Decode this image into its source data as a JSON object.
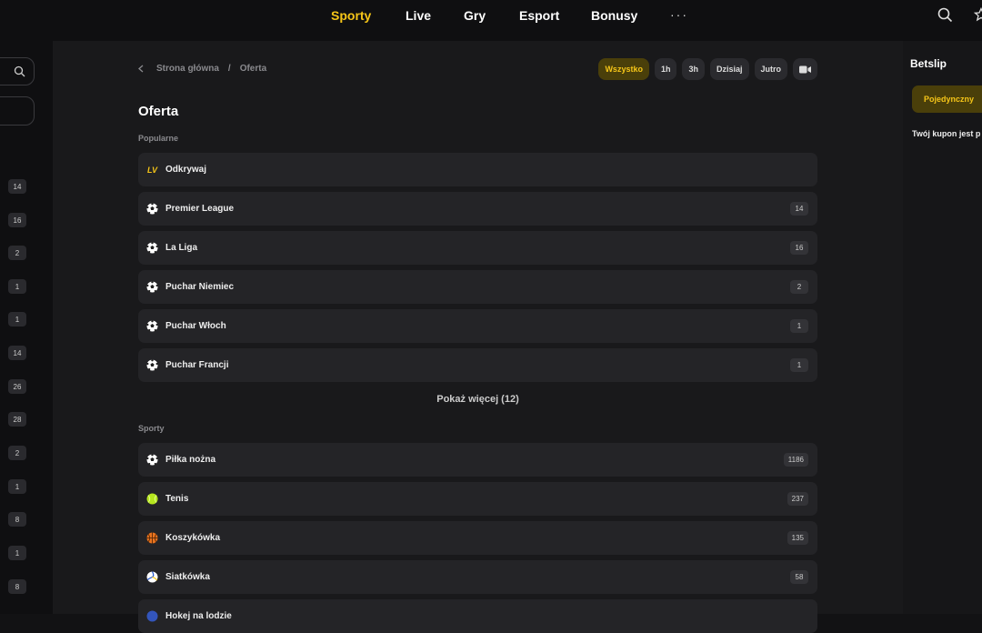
{
  "nav": {
    "items": [
      {
        "label": "Sporty",
        "active": true
      },
      {
        "label": "Live",
        "active": false
      },
      {
        "label": "Gry",
        "active": false
      },
      {
        "label": "Esport",
        "active": false
      },
      {
        "label": "Bonusy",
        "active": false
      }
    ],
    "more": "···",
    "icons": [
      "search-icon",
      "star-icon"
    ]
  },
  "sidebar": {
    "counts": [
      "14",
      "16",
      "2",
      "1",
      "1",
      "14",
      "26",
      "28",
      "2",
      "1",
      "8",
      "1",
      "8"
    ]
  },
  "breadcrumb": {
    "home": "Strona główna",
    "separator": "/",
    "current": "Oferta"
  },
  "filters": [
    "Wszystko",
    "1h",
    "3h",
    "Dzisiaj",
    "Jutro"
  ],
  "page_title": "Oferta",
  "popular": {
    "label": "Popularne",
    "items": [
      {
        "label": "Odkrywaj",
        "icon": "lv-logo-icon",
        "count": ""
      },
      {
        "label": "Premier League",
        "icon": "football-icon",
        "count": "14"
      },
      {
        "label": "La Liga",
        "icon": "football-icon",
        "count": "16"
      },
      {
        "label": "Puchar Niemiec",
        "icon": "football-icon",
        "count": "2"
      },
      {
        "label": "Puchar Włoch",
        "icon": "football-icon",
        "count": "1"
      },
      {
        "label": "Puchar Francji",
        "icon": "football-icon",
        "count": "1"
      }
    ],
    "show_more": "Pokaż więcej (12)"
  },
  "sports": {
    "label": "Sporty",
    "items": [
      {
        "label": "Piłka nożna",
        "icon": "football-icon",
        "count": "1186"
      },
      {
        "label": "Tenis",
        "icon": "tennis-ball-icon",
        "count": "237"
      },
      {
        "label": "Koszykówka",
        "icon": "basketball-icon",
        "count": "135"
      },
      {
        "label": "Siatkówka",
        "icon": "volleyball-icon",
        "count": "58"
      },
      {
        "label": "Hokej na lodzie",
        "icon": "hockey-icon",
        "count": ""
      }
    ]
  },
  "betslip": {
    "title": "Betslip",
    "tab": "Pojedynczny",
    "empty": "Twój kupon jest p"
  },
  "colors": {
    "accent": "#f5c518",
    "background": "#19191b",
    "row": "#242427"
  }
}
